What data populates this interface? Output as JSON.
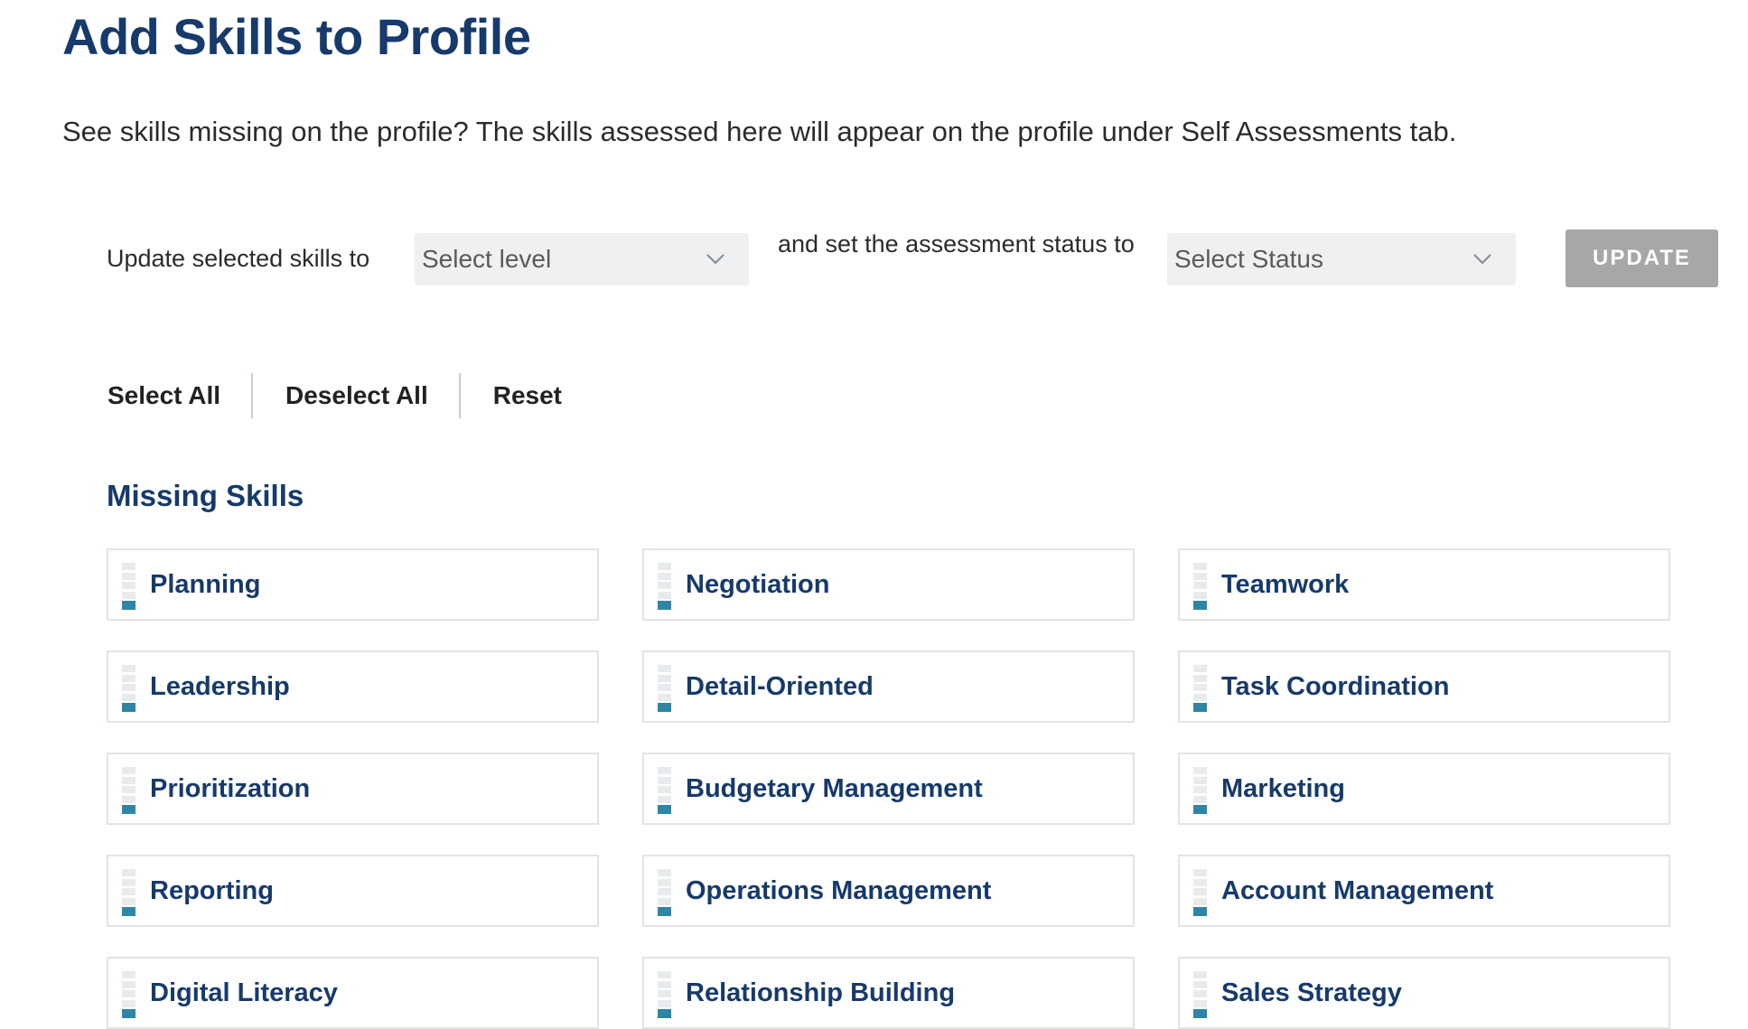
{
  "page": {
    "title": "Add Skills to Profile",
    "description": "See skills missing on the profile? The skills assessed here will appear on the profile under Self Assessments tab."
  },
  "controls": {
    "update_prefix": "Update selected skills to",
    "level_select": {
      "value": "Select level"
    },
    "status_prefix": "and set the assessment status to",
    "status_select": {
      "value": "Select Status"
    },
    "update_button": "UPDATE"
  },
  "actions": {
    "select_all": "Select All",
    "deselect_all": "Deselect All",
    "reset": "Reset"
  },
  "section": {
    "title": "Missing Skills",
    "skills": [
      {
        "name": "Planning"
      },
      {
        "name": "Negotiation"
      },
      {
        "name": "Teamwork"
      },
      {
        "name": "Leadership"
      },
      {
        "name": "Detail-Oriented"
      },
      {
        "name": "Task Coordination"
      },
      {
        "name": "Prioritization"
      },
      {
        "name": "Budgetary Management"
      },
      {
        "name": "Marketing"
      },
      {
        "name": "Reporting"
      },
      {
        "name": "Operations Management"
      },
      {
        "name": "Account Management"
      },
      {
        "name": "Digital Literacy"
      },
      {
        "name": "Relationship Building"
      },
      {
        "name": "Sales Strategy"
      }
    ],
    "meter": {
      "levels": 5,
      "filled": 1
    }
  },
  "colors": {
    "heading": "#163a6b",
    "accent": "#2e86a6",
    "button_disabled": "#a7a7a7",
    "select_bg": "#eff0f2"
  }
}
